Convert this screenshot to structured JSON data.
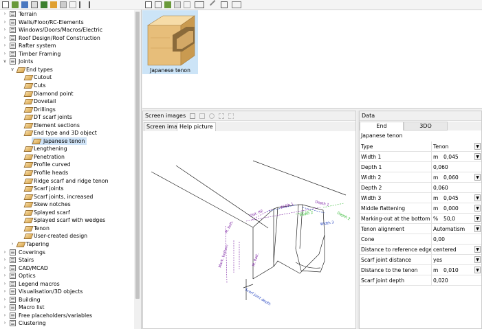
{
  "tree": {
    "items": [
      {
        "label": "Terrain",
        "level": 0,
        "exp": ">",
        "type": "folder"
      },
      {
        "label": "Walls/Floor/RC-Elements",
        "level": 0,
        "exp": ">",
        "type": "folder"
      },
      {
        "label": "Windows/Doors/Macros/Electric",
        "level": 0,
        "exp": ">",
        "type": "folder"
      },
      {
        "label": "Roof Design/Roof Construction",
        "level": 0,
        "exp": ">",
        "type": "folder"
      },
      {
        "label": "Rafter system",
        "level": 0,
        "exp": ">",
        "type": "folder"
      },
      {
        "label": "Timber Framing",
        "level": 0,
        "exp": ">",
        "type": "folder"
      },
      {
        "label": "Joints",
        "level": 0,
        "exp": "v",
        "type": "folder"
      },
      {
        "label": "End types",
        "level": 1,
        "exp": "v",
        "type": "joint"
      },
      {
        "label": "Cutout",
        "level": 2,
        "exp": "",
        "type": "joint"
      },
      {
        "label": "Cuts",
        "level": 2,
        "exp": "",
        "type": "joint"
      },
      {
        "label": "Diamond point",
        "level": 2,
        "exp": "",
        "type": "joint"
      },
      {
        "label": "Dovetail",
        "level": 2,
        "exp": "",
        "type": "joint"
      },
      {
        "label": "Drillings",
        "level": 2,
        "exp": "",
        "type": "joint"
      },
      {
        "label": "DT scarf joints",
        "level": 2,
        "exp": "",
        "type": "joint"
      },
      {
        "label": "Element sections",
        "level": 2,
        "exp": "",
        "type": "joint"
      },
      {
        "label": "End type and 3D object",
        "level": 2,
        "exp": "",
        "type": "joint"
      },
      {
        "label": "Japanese tenon",
        "level": 2,
        "exp": "",
        "type": "joint",
        "selected": true
      },
      {
        "label": "Lengthening",
        "level": 2,
        "exp": "",
        "type": "joint"
      },
      {
        "label": "Penetration",
        "level": 2,
        "exp": "",
        "type": "joint"
      },
      {
        "label": "Profile curved",
        "level": 2,
        "exp": "",
        "type": "joint"
      },
      {
        "label": "Profile heads",
        "level": 2,
        "exp": "",
        "type": "joint"
      },
      {
        "label": "Ridge scarf and ridge tenon",
        "level": 2,
        "exp": "",
        "type": "joint"
      },
      {
        "label": "Scarf joints",
        "level": 2,
        "exp": "",
        "type": "joint"
      },
      {
        "label": "Scarf joints, increased",
        "level": 2,
        "exp": "",
        "type": "joint"
      },
      {
        "label": "Skew notches",
        "level": 2,
        "exp": "",
        "type": "joint"
      },
      {
        "label": "Splayed scarf",
        "level": 2,
        "exp": "",
        "type": "joint"
      },
      {
        "label": "Splayed scarf with wedges",
        "level": 2,
        "exp": "",
        "type": "joint"
      },
      {
        "label": "Tenon",
        "level": 2,
        "exp": "",
        "type": "joint"
      },
      {
        "label": "User-created design",
        "level": 2,
        "exp": "",
        "type": "joint"
      },
      {
        "label": "Tapering",
        "level": 1,
        "exp": ">",
        "type": "joint"
      },
      {
        "label": "Coverings",
        "level": 0,
        "exp": ">",
        "type": "folder"
      },
      {
        "label": "Stairs",
        "level": 0,
        "exp": ">",
        "type": "folder"
      },
      {
        "label": "CAD/MCAD",
        "level": 0,
        "exp": ">",
        "type": "folder"
      },
      {
        "label": "Optics",
        "level": 0,
        "exp": ">",
        "type": "folder"
      },
      {
        "label": "Legend macros",
        "level": 0,
        "exp": ">",
        "type": "folder"
      },
      {
        "label": "Visualisation/3D objects",
        "level": 0,
        "exp": ">",
        "type": "folder"
      },
      {
        "label": "Building",
        "level": 0,
        "exp": ">",
        "type": "folder"
      },
      {
        "label": "Macro list",
        "level": 0,
        "exp": ">",
        "type": "folder"
      },
      {
        "label": "Free placeholders/variables",
        "level": 0,
        "exp": ">",
        "type": "folder"
      },
      {
        "label": "Clustering",
        "level": 0,
        "exp": ">",
        "type": "folder"
      }
    ]
  },
  "thumbnail": {
    "caption": "Japanese tenon"
  },
  "screen_images": {
    "header": "Screen images",
    "tabs": [
      "Screen image",
      "Help picture"
    ],
    "labels": {
      "dist_re": "Dist. RE",
      "width1": "Width 1",
      "depth1": "Depth 1",
      "width2": "Width 2",
      "depth2": "Depth 2",
      "width3": "Width 3",
      "m_bottom": "M. bott.",
      "mflat": "M. flatt.",
      "mark_bottom": "Mark. bottom",
      "scarf_depth": "Scarf joint depth"
    }
  },
  "data": {
    "header": "Data",
    "tabs": [
      "End",
      "3DO"
    ],
    "title": "Japanese tenon",
    "rows": [
      {
        "label": "Type",
        "unit": "",
        "value": "Tenon",
        "dropdown": true
      },
      {
        "label": "Width 1",
        "unit": "m",
        "value": "0,045",
        "dropdown": true
      },
      {
        "label": "Depth 1",
        "unit": "",
        "value": "0,060",
        "dropdown": false
      },
      {
        "label": "Width 2",
        "unit": "m",
        "value": "0,060",
        "dropdown": true
      },
      {
        "label": "Depth 2",
        "unit": "",
        "value": "0,060",
        "dropdown": false
      },
      {
        "label": "Width 3",
        "unit": "m",
        "value": "0,045",
        "dropdown": true
      },
      {
        "label": "Middle flattening",
        "unit": "m",
        "value": "0,000",
        "dropdown": true
      },
      {
        "label": "Marking-out at the bottom",
        "unit": "%",
        "value": "50,0",
        "dropdown": true
      },
      {
        "label": "Tenon alignment",
        "unit": "",
        "value": "Automatism",
        "dropdown": true
      },
      {
        "label": "Cone",
        "unit": "",
        "value": "0,00",
        "dropdown": false
      },
      {
        "label": "Distance to reference edge",
        "unit": "",
        "value": "centered",
        "dropdown": true
      },
      {
        "label": "Scarf joint distance",
        "unit": "",
        "value": "yes",
        "dropdown": true
      },
      {
        "label": "Distance to the tenon",
        "unit": "m",
        "value": "0,010",
        "dropdown": true
      },
      {
        "label": "Scarf joint depth",
        "unit": "",
        "value": "0,020",
        "dropdown": false
      }
    ]
  },
  "colors": {
    "selection": "#cce4f7",
    "dim_purple": "#7a1fa2",
    "dim_green": "#2eb82e",
    "dim_blue": "#1f3fbf"
  }
}
